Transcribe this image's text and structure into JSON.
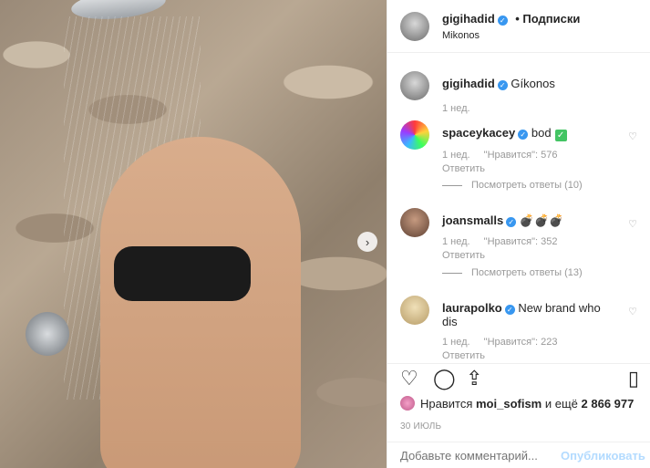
{
  "post": {
    "author": "gigihadid",
    "follow_label": "• Подписки",
    "location": "Mikonos",
    "caption_author": "gigihadid",
    "caption_text": "Gíkonos",
    "caption_age": "1 нед."
  },
  "comments": [
    {
      "user": "spaceykacey",
      "text": "bod",
      "has_check_emoji": true,
      "age": "1 нед.",
      "likes": "\"Нравится\": 576",
      "reply": "Ответить",
      "view_replies": "Посмотреть ответы (10)"
    },
    {
      "user": "joansmalls",
      "text": "💣💣💣",
      "age": "1 нед.",
      "likes": "\"Нравится\": 352",
      "reply": "Ответить",
      "view_replies": "Посмотреть ответы (13)"
    },
    {
      "user": "laurapolko",
      "text": "New brand who dis",
      "age": "1 нед.",
      "likes": "\"Нравится\": 223",
      "reply": "Ответить"
    }
  ],
  "likes": {
    "prefix": "Нравится",
    "user": "moi_sofism",
    "suffix": "и ещё",
    "count": "2 866 977"
  },
  "date": "30 ИЮЛЬ",
  "add_comment": {
    "placeholder": "Добавьте комментарий...",
    "publish": "Опубликовать"
  },
  "colors": {
    "verified": "#3897f0",
    "publish_disabled": "#b3dbff",
    "muted_text": "#999999"
  },
  "icons": [
    "heart-icon",
    "comment-icon",
    "share-icon",
    "bookmark-icon",
    "next-arrow-icon",
    "verified-icon",
    "like-heart-icon"
  ]
}
